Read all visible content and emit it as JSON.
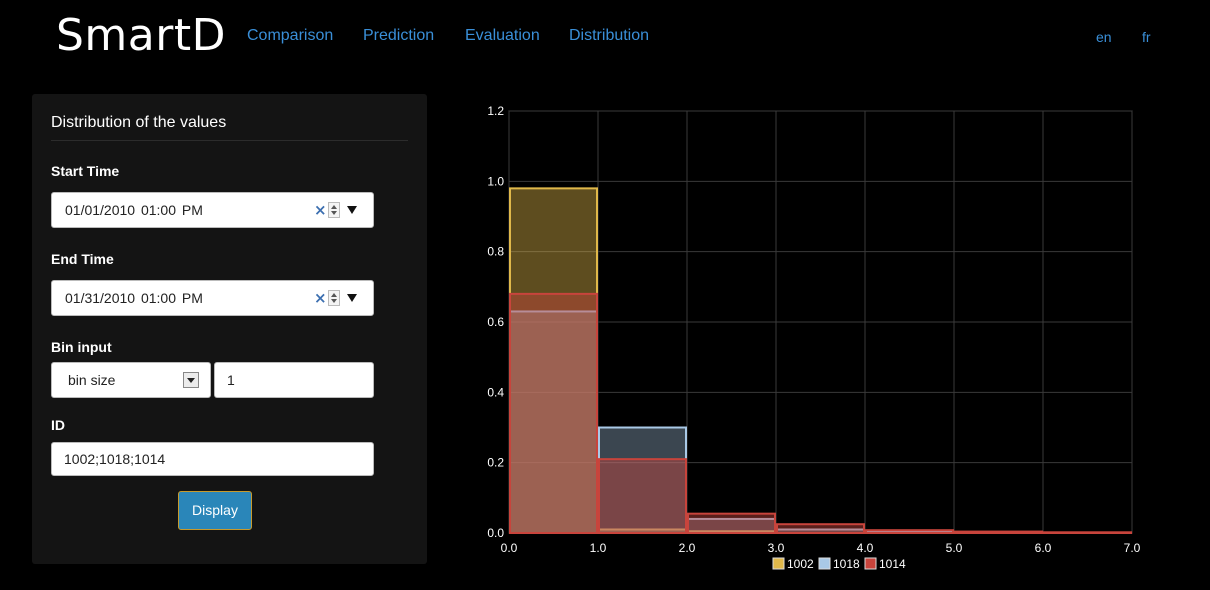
{
  "app": {
    "title": "SmartD"
  },
  "nav": {
    "items": [
      "Comparison",
      "Prediction",
      "Evaluation",
      "Distribution"
    ],
    "languages": [
      "en",
      "fr"
    ]
  },
  "panel": {
    "title": "Distribution of the values",
    "start_time": {
      "label": "Start Time",
      "value": "01/01/2010  01:00  PM"
    },
    "end_time": {
      "label": "End Time",
      "value": "01/31/2010  01:00  PM"
    },
    "bin_input": {
      "label": "Bin input",
      "selected": "bin size",
      "value": "1"
    },
    "id": {
      "label": "ID",
      "value": "1002;1018;1014"
    },
    "display_label": "Display"
  },
  "icons": {
    "clear": "×",
    "spinner": "up-down-spinner-icon",
    "dropdown": "caret-down-icon"
  },
  "colors": {
    "nav_link": "#3a8fd8",
    "button": "#2a86b9",
    "s1002": "#e0b84a",
    "s1018": "#a9c9e6",
    "s1014": "#c8443c"
  },
  "chart_data": {
    "type": "bar",
    "bins": [
      0,
      1,
      2,
      3,
      4,
      5,
      6,
      7
    ],
    "x_ticks": [
      "0.0",
      "1.0",
      "2.0",
      "3.0",
      "4.0",
      "5.0",
      "6.0",
      "7.0"
    ],
    "y_ticks": [
      "0.0",
      "0.2",
      "0.4",
      "0.6",
      "0.8",
      "1.0",
      "1.2"
    ],
    "xlim": [
      0,
      7
    ],
    "ylim": [
      0,
      1.2
    ],
    "grid": true,
    "legend_position": "bottom",
    "series": [
      {
        "name": "1002",
        "values": [
          0.98,
          0.01,
          0.005,
          0.0,
          0.0,
          0.0,
          0.0
        ]
      },
      {
        "name": "1018",
        "values": [
          0.63,
          0.3,
          0.04,
          0.01,
          0.005,
          0.003,
          0.0
        ]
      },
      {
        "name": "1014",
        "values": [
          0.68,
          0.21,
          0.055,
          0.025,
          0.008,
          0.004,
          0.002
        ]
      }
    ]
  }
}
